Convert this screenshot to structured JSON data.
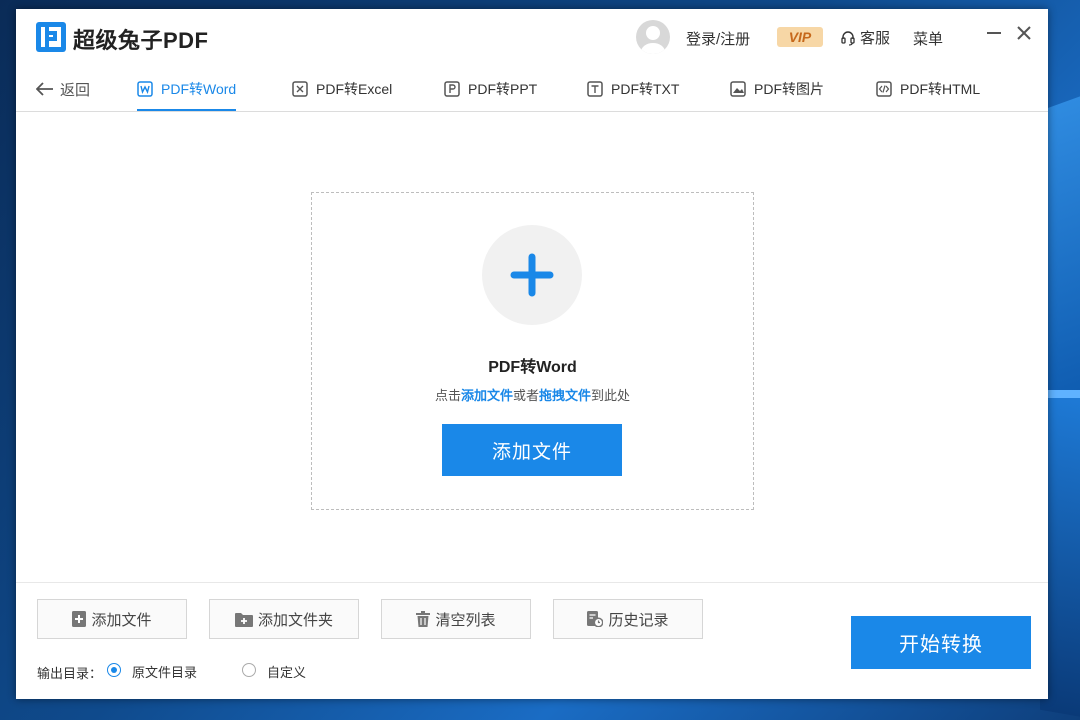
{
  "app": {
    "title": "超级兔子PDF"
  },
  "header": {
    "login_label": "登录/注册",
    "vip_label": "VIP",
    "support_label": "客服",
    "menu_label": "菜单"
  },
  "nav": {
    "back_label": "返回",
    "tabs": [
      {
        "label": "PDF转Word",
        "icon": "word-icon",
        "active": true
      },
      {
        "label": "PDF转Excel",
        "icon": "excel-icon",
        "active": false
      },
      {
        "label": "PDF转PPT",
        "icon": "ppt-icon",
        "active": false
      },
      {
        "label": "PDF转TXT",
        "icon": "txt-icon",
        "active": false
      },
      {
        "label": "PDF转图片",
        "icon": "image-icon",
        "active": false
      },
      {
        "label": "PDF转HTML",
        "icon": "html-icon",
        "active": false
      }
    ]
  },
  "dropzone": {
    "title": "PDF转Word",
    "hint_prefix": "点击",
    "hint_link1": "添加文件",
    "hint_mid": "或者",
    "hint_link2": "拖拽文件",
    "hint_suffix": "到此处",
    "add_button": "添加文件"
  },
  "toolbar": {
    "add_file": "添加文件",
    "add_folder": "添加文件夹",
    "clear_list": "清空列表",
    "history": "历史记录"
  },
  "output": {
    "label": "输出目录：",
    "options": [
      {
        "label": "原文件目录",
        "selected": true
      },
      {
        "label": "自定义",
        "selected": false
      }
    ]
  },
  "start_button": "开始转换",
  "colors": {
    "accent": "#1a88e8",
    "vip_bg": "#f7d7a6",
    "vip_text": "#c6681b"
  }
}
